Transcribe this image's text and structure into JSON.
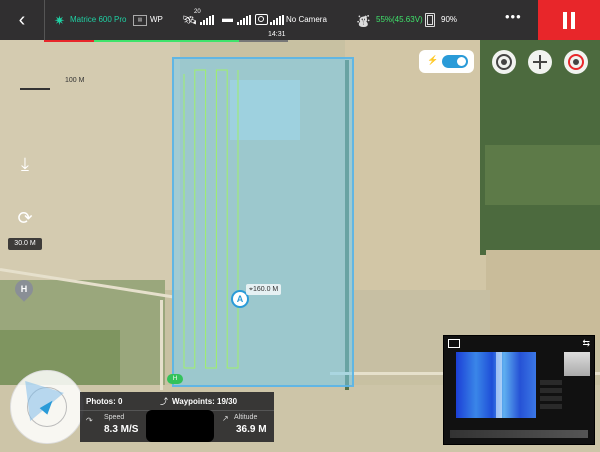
{
  "app": {
    "aircraft": "Matrice 600 Pro",
    "mode": "WP",
    "satellite_count": "20",
    "camera_status": "No Camera",
    "battery_primary": "55%(45.63V)",
    "battery_secondary": "90%",
    "flight_time": "14:31",
    "more_label": "•••",
    "back_icon": "chevron-left-icon",
    "pause_icon": "pause-icon"
  },
  "map": {
    "scale_label": "100 M",
    "segment_distance": "160.0 M",
    "start_label": "H",
    "home_label": "H",
    "waypoint_marker": "A",
    "flight_lines": 6
  },
  "left_controls": {
    "takeoff_altitude": "30.0 M"
  },
  "telemetry": {
    "photos": "Photos: 0",
    "waypoints": "Waypoints: 19/30",
    "speed_label": "Speed",
    "speed_value": "8.3 M/S",
    "altitude_label": "Altitude",
    "altitude_value": "36.9 M"
  },
  "colors": {
    "accent": "#2a9bd8",
    "ok": "#3fe36b",
    "brand": "#1fd0a3",
    "alert": "#e8262a"
  },
  "progress": {
    "mission_fraction": 0.8
  }
}
